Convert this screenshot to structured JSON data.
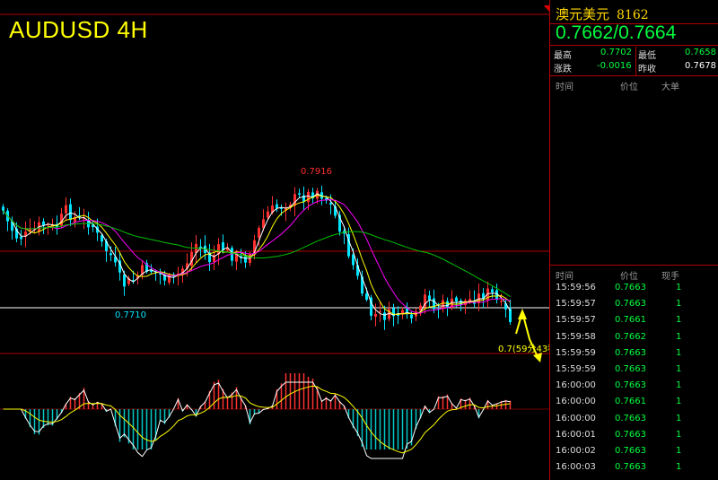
{
  "chart": {
    "title": "AUDUSD 4H",
    "high_label": "0.7916",
    "low_label": "0.7710",
    "countdown_label": "0.7(59分43秒",
    "colors": {
      "up": "#ff3030",
      "down": "#00e5ff",
      "ma_fast": "#ffffff",
      "ma_mid": "#ffff00",
      "ma_slow": "#ff00ff",
      "ma_long": "#00c000",
      "grid": "#b00000",
      "hline": "#ffffff",
      "macd_up": "#ff3030",
      "macd_down": "#00c8c8"
    }
  },
  "panel": {
    "symbol_name": "澳元美元",
    "symbol_code": "8162",
    "quote": "0.7662/0.7664",
    "stats": {
      "high_label": "最高",
      "high_value": "0.7702",
      "low_label": "最低",
      "low_value": "0.7658",
      "change_label": "涨跌",
      "change_value": "-0.0016",
      "prev_close_label": "昨收",
      "prev_close_value": "0.7678"
    },
    "big_orders_header": {
      "time": "时间",
      "price": "价位",
      "big": "大单"
    },
    "trades_header": {
      "time": "时间",
      "price": "价位",
      "volume": "现手"
    },
    "trades": [
      {
        "time": "15:59:56",
        "price": "0.7663",
        "volume": "1"
      },
      {
        "time": "15:59:57",
        "price": "0.7663",
        "volume": "1"
      },
      {
        "time": "15:59:57",
        "price": "0.7661",
        "volume": "1"
      },
      {
        "time": "15:59:58",
        "price": "0.7662",
        "volume": "1"
      },
      {
        "time": "15:59:59",
        "price": "0.7663",
        "volume": "1"
      },
      {
        "time": "15:59:59",
        "price": "0.7663",
        "volume": "1"
      },
      {
        "time": "16:00:00",
        "price": "0.7663",
        "volume": "1"
      },
      {
        "time": "16:00:00",
        "price": "0.7661",
        "volume": "1"
      },
      {
        "time": "16:00:00",
        "price": "0.7663",
        "volume": "1"
      },
      {
        "time": "16:00:01",
        "price": "0.7663",
        "volume": "1"
      },
      {
        "time": "16:00:02",
        "price": "0.7663",
        "volume": "1"
      },
      {
        "time": "16:00:03",
        "price": "0.7663",
        "volume": "1"
      }
    ]
  }
}
